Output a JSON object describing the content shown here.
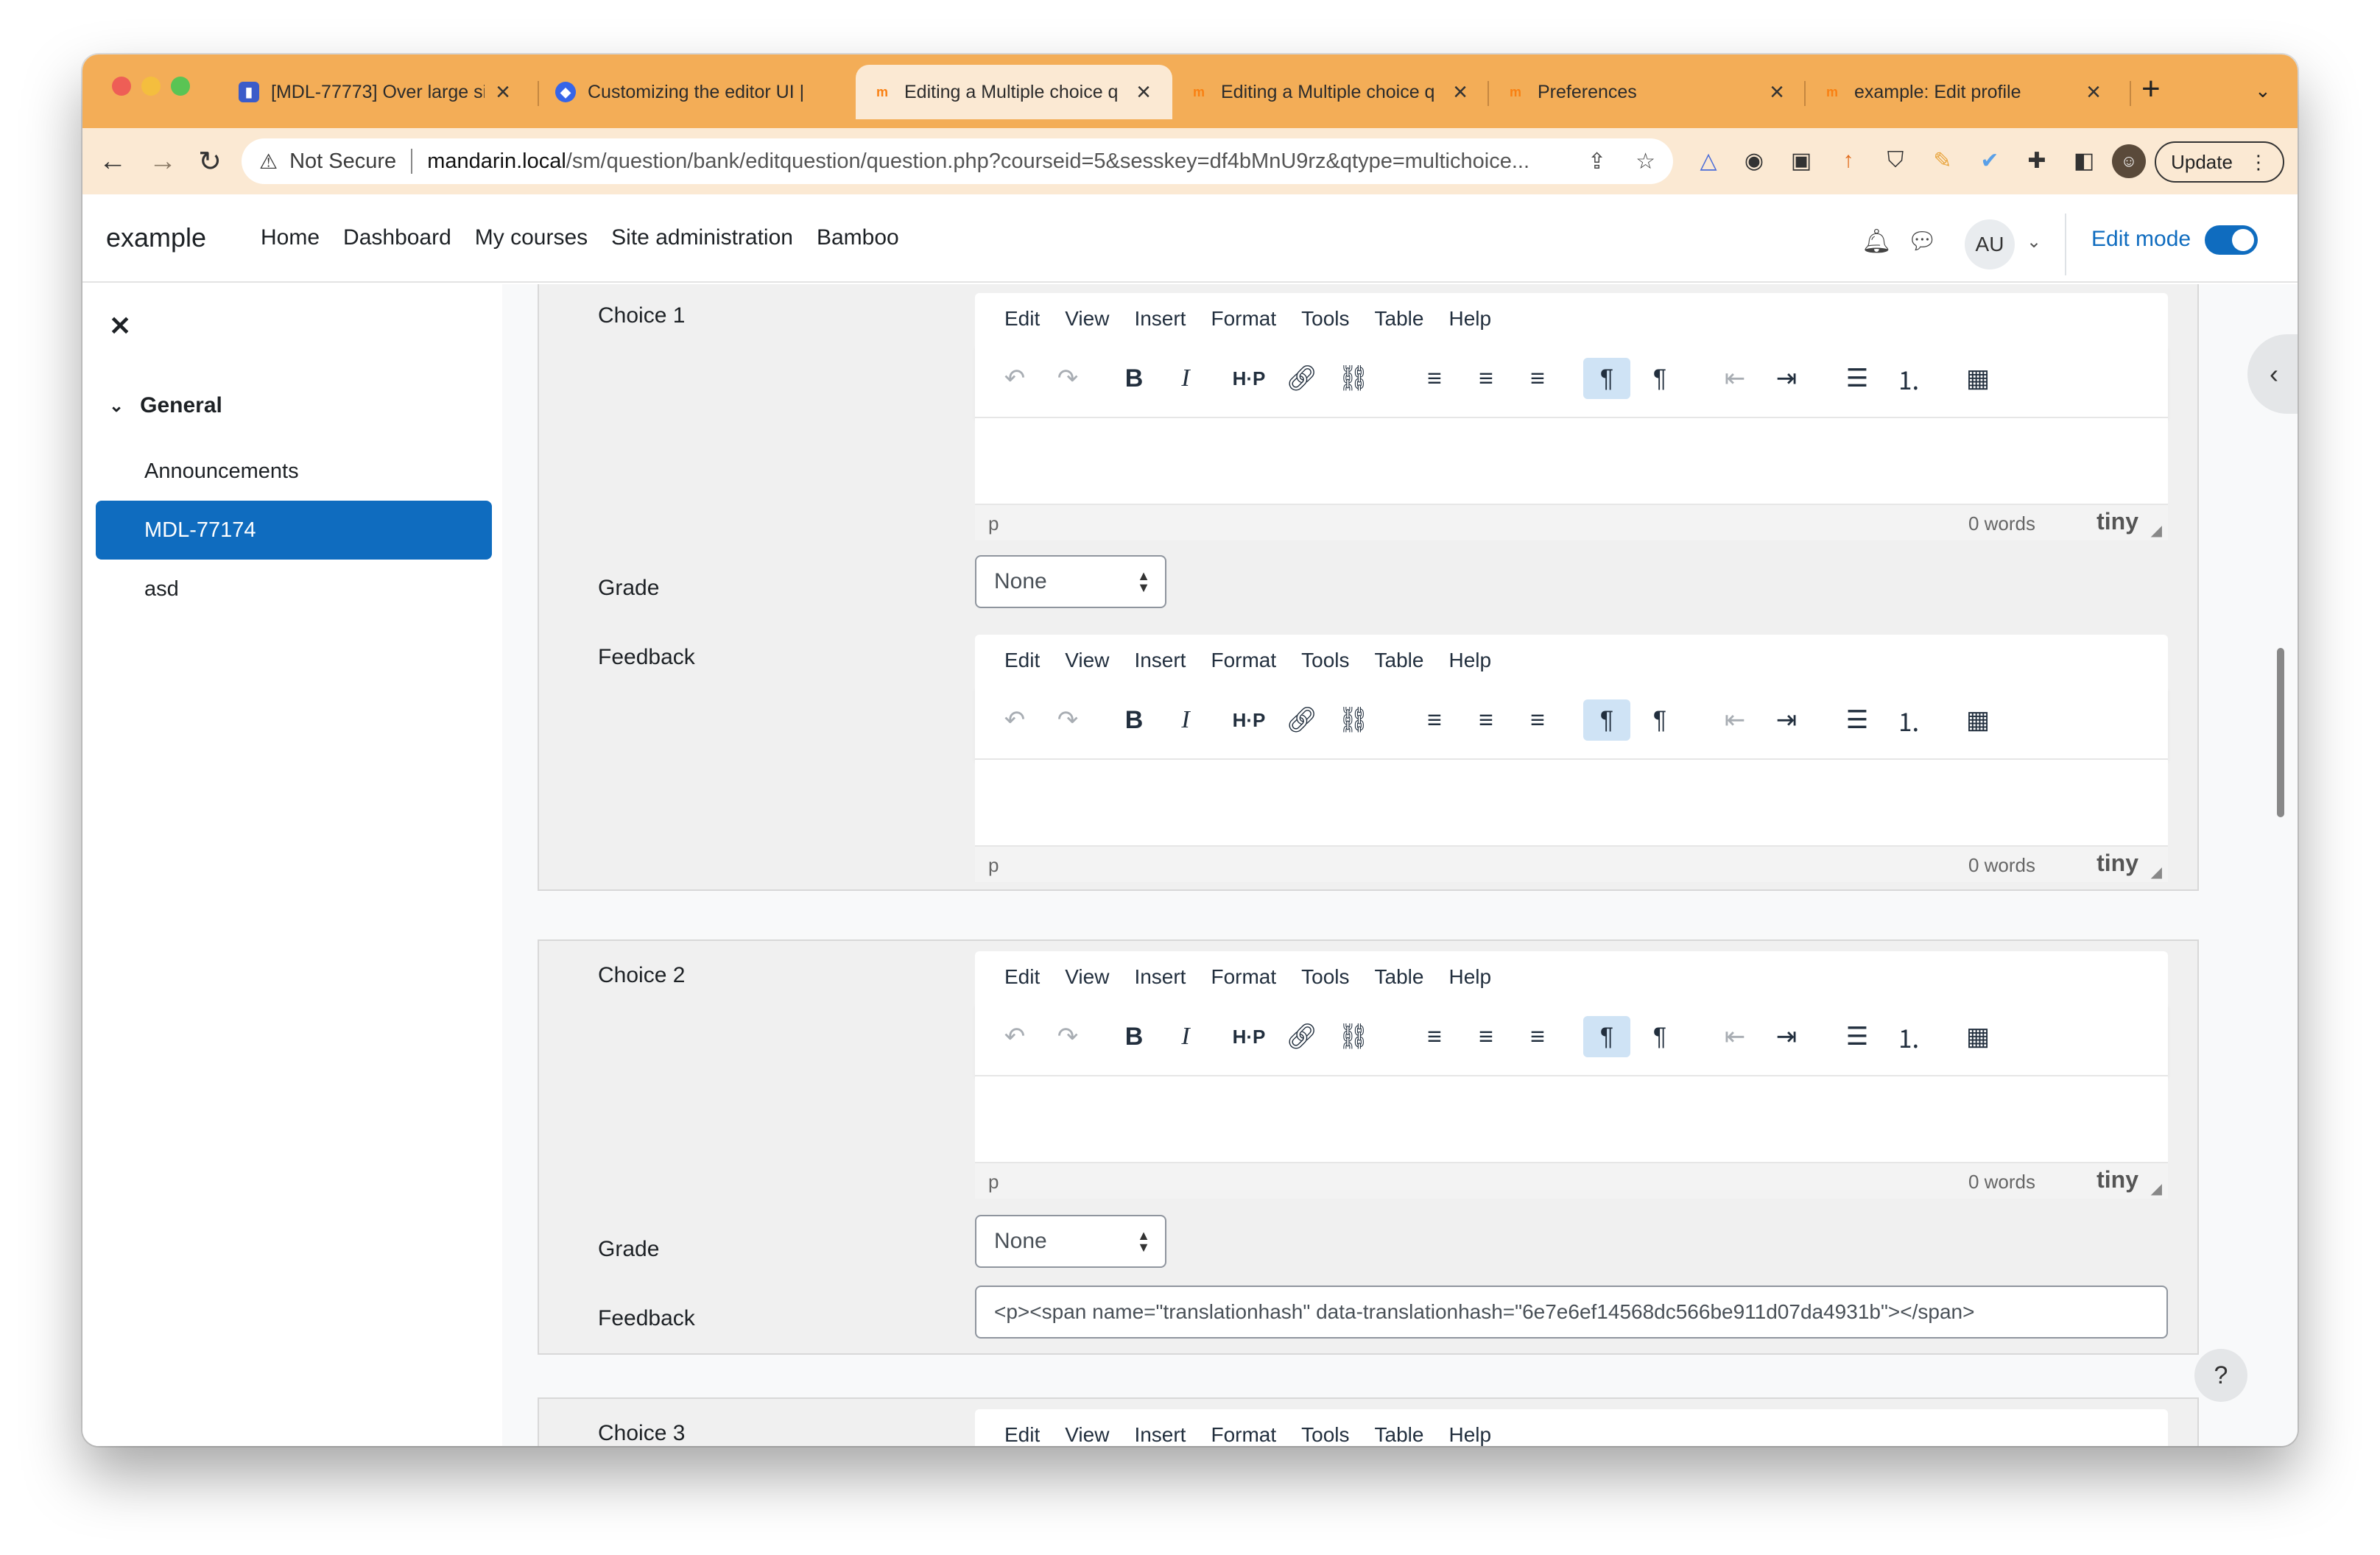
{
  "browser": {
    "tabs": [
      {
        "title": "[MDL-77773] Over large si",
        "favicon": "jira-icon"
      },
      {
        "title": "Customizing the editor UI |",
        "favicon": "tiny-docs-icon"
      },
      {
        "title": "Editing a Multiple choice q",
        "favicon": "moodle-icon"
      },
      {
        "title": "Editing a Multiple choice q",
        "favicon": "moodle-icon"
      },
      {
        "title": "Preferences",
        "favicon": "moodle-icon"
      },
      {
        "title": "example: Edit profile",
        "favicon": "moodle-icon"
      }
    ],
    "new_tab": "+",
    "security_label": "Not Secure",
    "url_host": "mandarin.local",
    "url_path": "/sm/question/bank/editquestion/question.php?courseid=5&sesskey=df4bMnU9rz&qtype=multichoice...",
    "update_label": "Update",
    "colors": {
      "tabstrip": "#f3ad57",
      "toolbar": "#fbe9d3"
    }
  },
  "site": {
    "brand": "example",
    "nav": [
      "Home",
      "Dashboard",
      "My courses",
      "Site administration",
      "Bamboo"
    ],
    "user_initials": "AU",
    "edit_mode_label": "Edit mode",
    "accent": "#0f6cbf"
  },
  "drawer": {
    "section": "General",
    "items": [
      {
        "label": "Announcements",
        "active": false
      },
      {
        "label": "MDL-77174",
        "active": true
      },
      {
        "label": "asd",
        "active": false
      }
    ]
  },
  "editor": {
    "menu": [
      "Edit",
      "View",
      "Insert",
      "Format",
      "Tools",
      "Table",
      "Help"
    ],
    "path": "p",
    "word_count": "0 words",
    "branding": "tiny"
  },
  "choices": [
    {
      "label": "Choice 1",
      "grade_label": "Grade",
      "grade_value": "None",
      "feedback_label": "Feedback"
    },
    {
      "label": "Choice 2",
      "grade_label": "Grade",
      "grade_value": "None",
      "feedback_label": "Feedback",
      "feedback_text": "<p><span name=\"translationhash\" data-translationhash=\"6e7e6ef14568dc566be911d07da4931b\"></span>"
    },
    {
      "label": "Choice 3"
    }
  ],
  "help_label": "?"
}
